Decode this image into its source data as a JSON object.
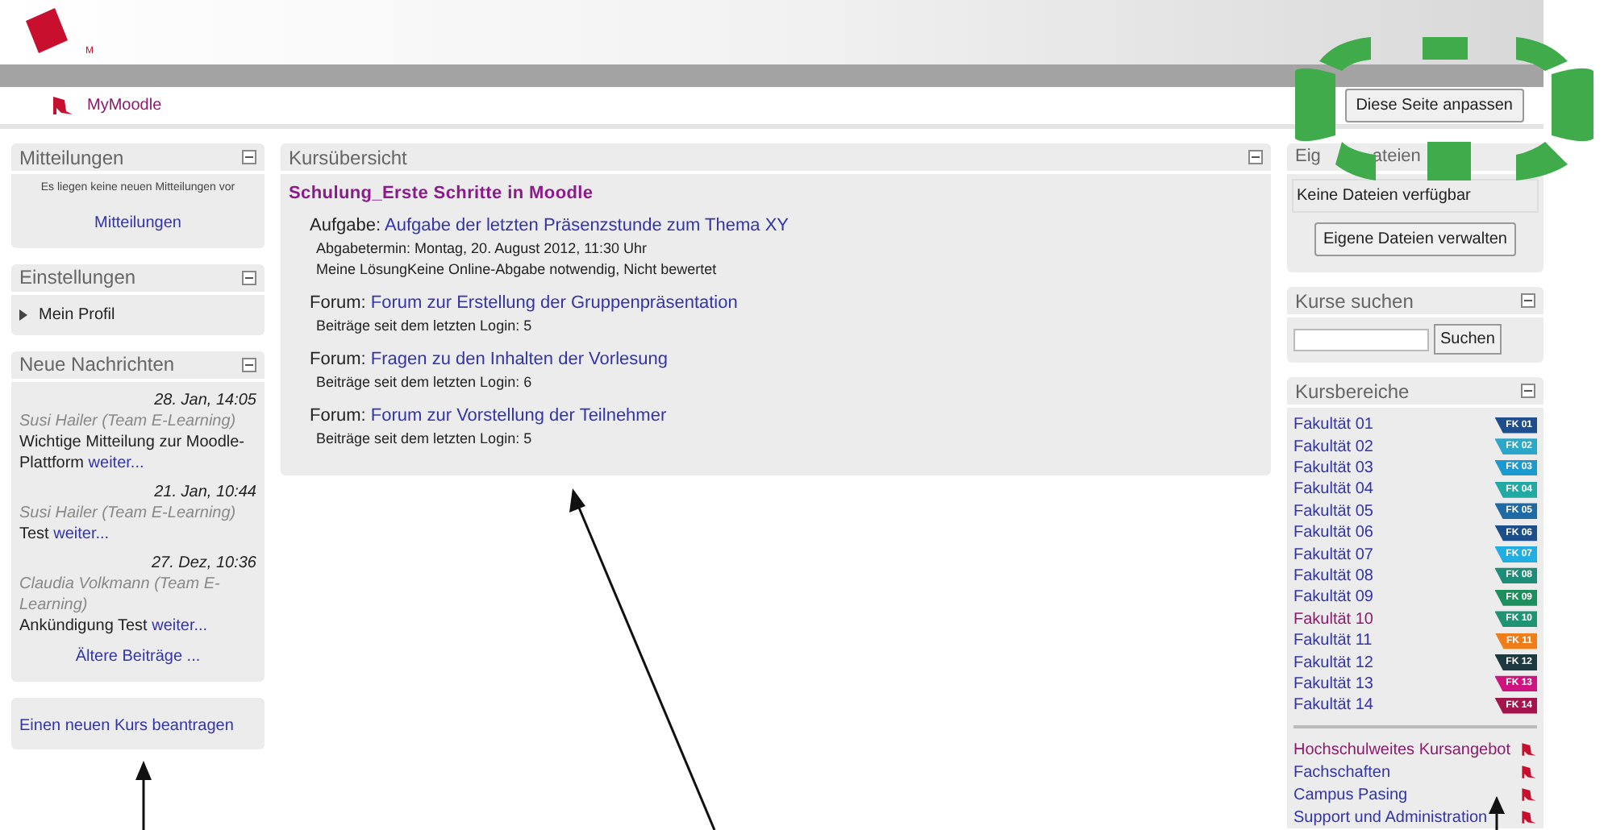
{
  "header": {
    "logo_mark": "M"
  },
  "nav": {
    "label": "MyMoodle",
    "customize_button": "Diese Seite anpassen"
  },
  "mitteilungen": {
    "title": "Mitteilungen",
    "text": "Es liegen keine neuen Mitteilungen vor",
    "link": "Mitteilungen"
  },
  "einstellungen": {
    "title": "Einstellungen",
    "items": [
      {
        "label": "Mein Profil",
        "expanded": false
      }
    ]
  },
  "nachrichten": {
    "title": "Neue Nachrichten",
    "posts": [
      {
        "date": "28. Jan, 14:05",
        "author": "Susi Hailer (Team E-Learning)",
        "subject": "Wichtige Mitteilung zur Moodle-Plattform",
        "more": "weiter..."
      },
      {
        "date": "21. Jan, 10:44",
        "author": "Susi Hailer (Team E-Learning)",
        "subject": "Test",
        "more": "weiter..."
      },
      {
        "date": "27. Dez, 10:36",
        "author": "Claudia Volkmann (Team E-Learning)",
        "subject": "Ankündigung Test",
        "more": "weiter..."
      }
    ],
    "older": "Ältere Beiträge ..."
  },
  "new_course_link": "Einen neuen Kurs beantragen",
  "overview": {
    "title": "Kursübersicht",
    "course": "Schulung_Erste Schritte in Moodle",
    "activities": [
      {
        "type": "Aufgabe:",
        "link": "Aufgabe der letzten Präsenzstunde zum Thema XY",
        "details": [
          "Abgabetermin: Montag, 20. August 2012, 11:30 Uhr",
          "Meine LösungKeine Online-Abgabe notwendig, Nicht bewertet"
        ]
      },
      {
        "type": "Forum:",
        "link": "Forum zur Erstellung der Gruppenpräsentation",
        "details": [
          "Beiträge seit dem letzten Login: 5"
        ]
      },
      {
        "type": "Forum:",
        "link": "Fragen zu den Inhalten der Vorlesung",
        "details": [
          "Beiträge seit dem letzten Login: 6"
        ]
      },
      {
        "type": "Forum:",
        "link": "Forum zur Vorstellung der Teilnehmer",
        "details": [
          "Beiträge seit dem letzten Login: 5"
        ]
      }
    ]
  },
  "files": {
    "title_parts": [
      "Eig",
      "ateien"
    ],
    "empty": "Keine Dateien verfügbar",
    "button": "Eigene Dateien verwalten"
  },
  "search": {
    "title": "Kurse suchen",
    "button": "Suchen"
  },
  "categories": {
    "title": "Kursbereiche",
    "items": [
      {
        "label": "Fakultät 01",
        "badge": "FK 01",
        "color": "#1f4e8c",
        "visited": false
      },
      {
        "label": "Fakultät 02",
        "badge": "FK 02",
        "color": "#2aa7c9",
        "visited": false
      },
      {
        "label": "Fakultät 03",
        "badge": "FK 03",
        "color": "#1a9ad0",
        "visited": false
      },
      {
        "label": "Fakultät 04",
        "badge": "FK 04",
        "color": "#23a9a4",
        "visited": false
      },
      {
        "label": "Fakultät 05",
        "badge": "FK 05",
        "color": "#1d6aa6",
        "visited": false
      },
      {
        "label": "Fakultät 06",
        "badge": "FK 06",
        "color": "#1c4f8a",
        "visited": false
      },
      {
        "label": "Fakultät 07",
        "badge": "FK 07",
        "color": "#22aee0",
        "visited": false
      },
      {
        "label": "Fakultät 08",
        "badge": "FK 08",
        "color": "#1e8d78",
        "visited": false
      },
      {
        "label": "Fakultät 09",
        "badge": "FK 09",
        "color": "#1d8f5c",
        "visited": false
      },
      {
        "label": "Fakultät 10",
        "badge": "FK 10",
        "color": "#1f9474",
        "visited": true
      },
      {
        "label": "Fakultät 11",
        "badge": "FK 11",
        "color": "#ee7d1a",
        "visited": false
      },
      {
        "label": "Fakultät 12",
        "badge": "FK 12",
        "color": "#1d3a40",
        "visited": false
      },
      {
        "label": "Fakultät 13",
        "badge": "FK 13",
        "color": "#d0147f",
        "visited": false
      },
      {
        "label": "Fakultät 14",
        "badge": "FK 14",
        "color": "#a3164d",
        "visited": false
      }
    ],
    "links": [
      {
        "label": "Hochschulweites Kursangebot",
        "visited": true
      },
      {
        "label": "Fachschaften",
        "visited": false
      },
      {
        "label": "Campus Pasing",
        "visited": false
      },
      {
        "label": "Support und Administration",
        "visited": false
      }
    ]
  }
}
